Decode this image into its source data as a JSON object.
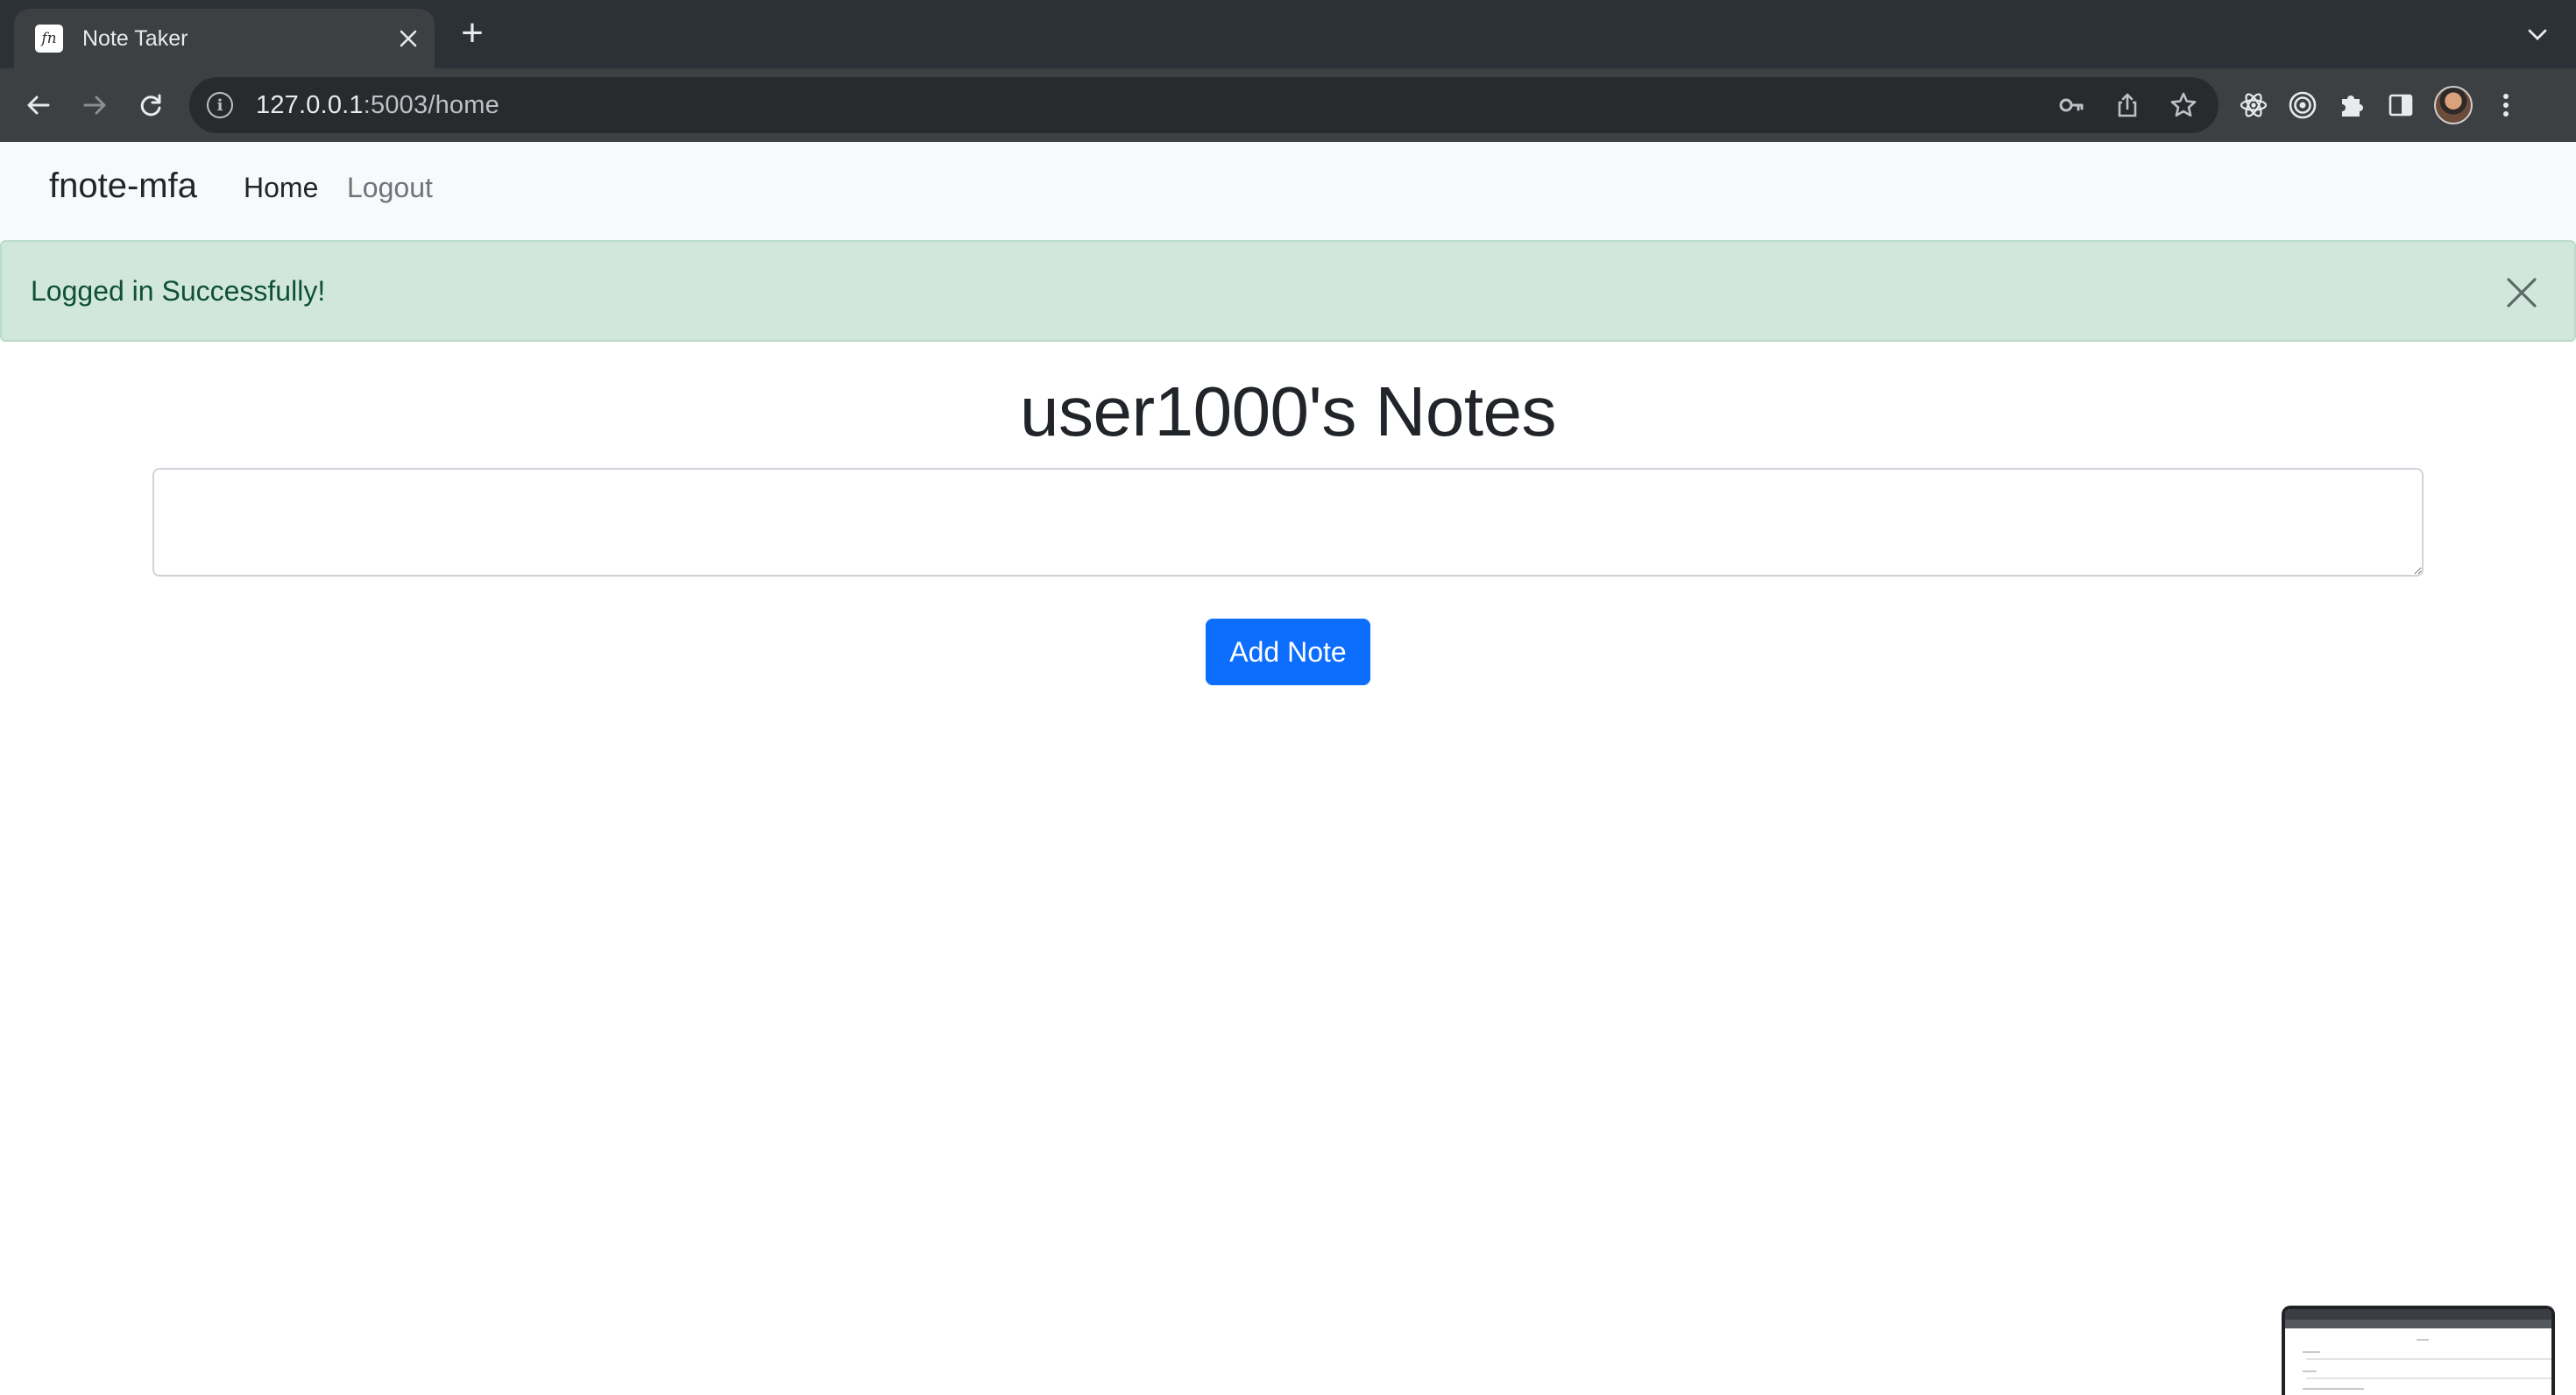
{
  "browser": {
    "tab_title": "Note Taker",
    "favicon_glyph": "fn",
    "new_tab_symbol": "+",
    "url_host": "127.0.0.1",
    "url_rest": ":5003/home"
  },
  "navbar": {
    "brand": "fnote-mfa",
    "links": [
      {
        "label": "Home"
      },
      {
        "label": "Logout"
      }
    ]
  },
  "alert": {
    "message": "Logged in Successfully!"
  },
  "main": {
    "heading": "user1000's Notes",
    "note_value": "",
    "add_button_label": "Add Note"
  },
  "colors": {
    "primary": "#0d6efd",
    "alert_bg": "#d1e7dd",
    "alert_text": "#0f5132",
    "navbar_bg": "#f8f9fa"
  }
}
